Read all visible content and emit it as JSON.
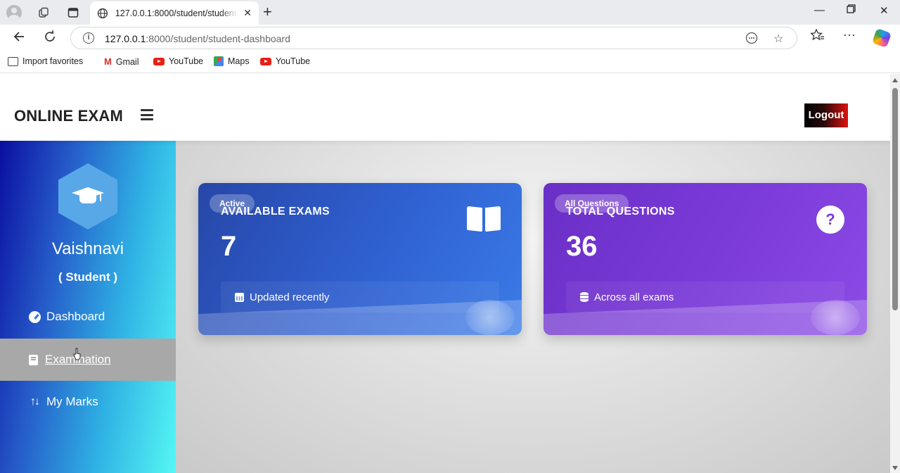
{
  "browser": {
    "tab_title": "127.0.0.1:8000/student/student-dashboard",
    "url_host": "127.0.0.1",
    "url_rest": ":8000/student/student-dashboard",
    "favorites": [
      {
        "label": "Import favorites",
        "icon": "import-icon"
      },
      {
        "label": "Gmail",
        "icon": "gmail-icon"
      },
      {
        "label": "YouTube",
        "icon": "youtube-icon"
      },
      {
        "label": "Maps",
        "icon": "maps-icon"
      },
      {
        "label": "YouTube",
        "icon": "youtube-icon"
      }
    ]
  },
  "header": {
    "brand": "ONLINE EXAM",
    "logout_label": "Logout"
  },
  "sidebar": {
    "user_name": "Vaishnavi",
    "user_role": "( Student )",
    "items": [
      {
        "label": "Dashboard",
        "icon": "dashboard-gauge-icon",
        "active": false
      },
      {
        "label": "Examination",
        "icon": "book-icon",
        "active": true
      },
      {
        "label": "My Marks",
        "icon": "sort-numeric-icon",
        "active": false
      }
    ]
  },
  "cards": [
    {
      "badge": "Active",
      "title": "AVAILABLE EXAMS",
      "value": "7",
      "footer": "Updated recently",
      "icon": "open-book-icon",
      "color": "#2f5fcf"
    },
    {
      "badge": "All Questions",
      "title": "TOTAL QUESTIONS",
      "value": "36",
      "footer": "Across all exams",
      "icon": "question-circle-icon",
      "color": "#7a3ad8"
    }
  ],
  "colors": {
    "logout_red": "#e01010",
    "sidebar_active": "#a8a8a8"
  }
}
